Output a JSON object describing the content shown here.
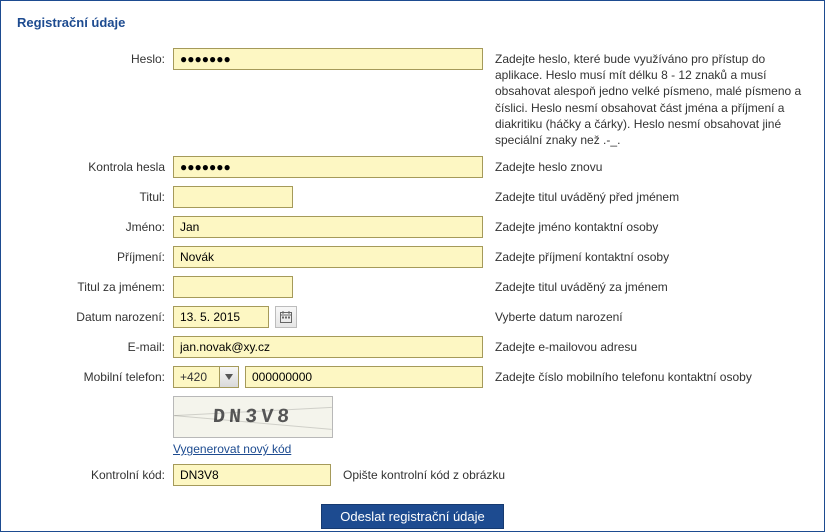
{
  "title": "Registrační údaje",
  "fields": {
    "password": {
      "label": "Heslo:",
      "value": "●●●●●●●",
      "hint": "Zadejte heslo, které bude využíváno pro přístup do aplikace. Heslo musí mít délku 8 - 12 znaků a musí obsahovat alespoň jedno velké písmeno, malé písmeno a číslici. Heslo nesmí obsahovat část jména a příjmení a diakritiku (háčky a čárky). Heslo nesmí obsahovat jiné speciální znaky než .-_."
    },
    "password2": {
      "label": "Kontrola hesla",
      "value": "●●●●●●●",
      "hint": "Zadejte heslo znovu"
    },
    "titlePre": {
      "label": "Titul:",
      "value": "",
      "hint": "Zadejte titul uváděný před jménem"
    },
    "firstName": {
      "label": "Jméno:",
      "value": "Jan",
      "hint": "Zadejte jméno kontaktní osoby"
    },
    "lastName": {
      "label": "Příjmení:",
      "value": "Novák",
      "hint": "Zadejte příjmení kontaktní osoby"
    },
    "titlePost": {
      "label": "Titul za jménem:",
      "value": "",
      "hint": "Zadejte titul uváděný za jménem"
    },
    "birthDate": {
      "label": "Datum narození:",
      "value": "13. 5. 2015",
      "hint": "Vyberte datum narození"
    },
    "email": {
      "label": "E-mail:",
      "value": "jan.novak@xy.cz",
      "hint": "Zadejte e-mailovou adresu"
    },
    "phone": {
      "label": "Mobilní telefon:",
      "prefix": "+420",
      "value": "000000000",
      "hint": "Zadejte číslo mobilního telefonu kontaktní osoby"
    },
    "captcha": {
      "image_code": "DN3V8",
      "regenerate": "Vygenerovat nový kód"
    },
    "control": {
      "label": "Kontrolní kód:",
      "value": "DN3V8",
      "hint": "Opište kontrolní kód z obrázku"
    }
  },
  "submit_label": "Odeslat registrační údaje"
}
